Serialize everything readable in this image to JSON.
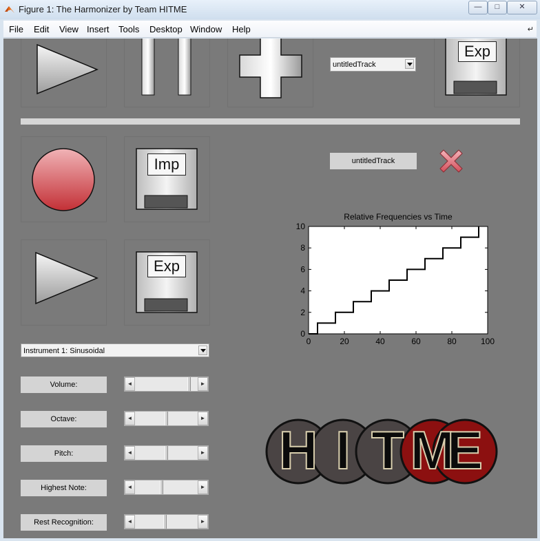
{
  "window": {
    "title": "Figure 1: The Harmonizer by Team HITME"
  },
  "menu": [
    "File",
    "Edit",
    "View",
    "Insert",
    "Tools",
    "Desktop",
    "Window",
    "Help"
  ],
  "track_select": {
    "value": "untitledTrack"
  },
  "track_name": "untitledTrack",
  "export_label": "Exp",
  "import_label": "Imp",
  "instrument_select": {
    "value": "Instrument 1: Sinusoidal"
  },
  "controls": [
    {
      "label": "Volume:",
      "level": 0.88
    },
    {
      "label": "Octave:",
      "level": 0.5
    },
    {
      "label": "Pitch:",
      "level": 0.5
    },
    {
      "label": "Highest Note:",
      "level": 0.42
    },
    {
      "label": "Rest Recognition:",
      "level": 0.48
    }
  ],
  "logo_letters": [
    "H",
    "I",
    "T",
    "M",
    "E"
  ],
  "colors": {
    "panel": "#7a7a7a",
    "record": "#d94a4f",
    "delete": "#e0707a",
    "logo_dark": "#4a4444",
    "logo_red": "#8c1010"
  },
  "chart_data": {
    "type": "line",
    "title": "Relative Frequencies vs Time",
    "xlim": [
      0,
      100
    ],
    "ylim": [
      0,
      10
    ],
    "xticks": [
      0,
      20,
      40,
      60,
      80,
      100
    ],
    "yticks": [
      0,
      2,
      4,
      6,
      8,
      10
    ],
    "series": [
      {
        "x": [
          0,
          5,
          5,
          15,
          15,
          25,
          25,
          35,
          35,
          45,
          45,
          55,
          55,
          65,
          65,
          75,
          75,
          85,
          85,
          95,
          95
        ],
        "y": [
          0,
          0,
          1,
          1,
          2,
          2,
          3,
          3,
          4,
          4,
          5,
          5,
          6,
          6,
          7,
          7,
          8,
          8,
          9,
          9,
          10
        ]
      }
    ]
  }
}
